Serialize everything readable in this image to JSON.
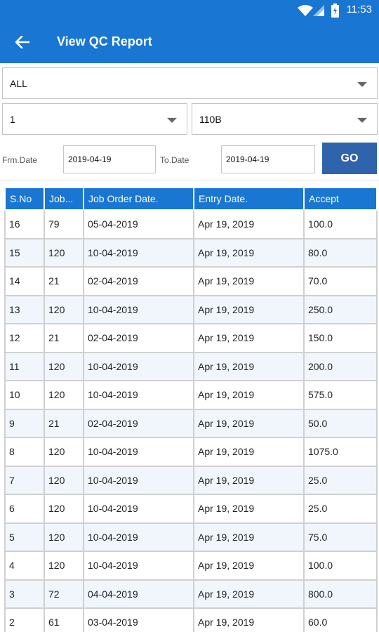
{
  "status_bar": {
    "time": "11:53"
  },
  "header": {
    "title": "View QC Report"
  },
  "filters": {
    "type_select": "ALL",
    "number_select": "1",
    "code_select": "110B",
    "from_label": "Frm.Date",
    "from_value": "2019-04-19",
    "to_label": "To.Date",
    "to_value": "2019-04-19",
    "go_label": "GO"
  },
  "table": {
    "columns": [
      "S.No",
      "Job...",
      "Job Order Date.",
      "Entry Date.",
      "Accept"
    ],
    "rows": [
      [
        "16",
        "79",
        "05-04-2019",
        "Apr 19, 2019",
        "100.0"
      ],
      [
        "15",
        "120",
        "10-04-2019",
        "Apr 19, 2019",
        "80.0"
      ],
      [
        "14",
        "21",
        "02-04-2019",
        "Apr 19, 2019",
        "70.0"
      ],
      [
        "13",
        "120",
        "10-04-2019",
        "Apr 19, 2019",
        "250.0"
      ],
      [
        "12",
        "21",
        "02-04-2019",
        "Apr 19, 2019",
        "150.0"
      ],
      [
        "11",
        "120",
        "10-04-2019",
        "Apr 19, 2019",
        "200.0"
      ],
      [
        "10",
        "120",
        "10-04-2019",
        "Apr 19, 2019",
        "575.0"
      ],
      [
        "9",
        "21",
        "02-04-2019",
        "Apr 19, 2019",
        "50.0"
      ],
      [
        "8",
        "120",
        "10-04-2019",
        "Apr 19, 2019",
        "1075.0"
      ],
      [
        "7",
        "120",
        "10-04-2019",
        "Apr 19, 2019",
        "25.0"
      ],
      [
        "6",
        "120",
        "10-04-2019",
        "Apr 19, 2019",
        "25.0"
      ],
      [
        "5",
        "120",
        "10-04-2019",
        "Apr 19, 2019",
        "75.0"
      ],
      [
        "4",
        "120",
        "10-04-2019",
        "Apr 19, 2019",
        "100.0"
      ],
      [
        "3",
        "72",
        "04-04-2019",
        "Apr 19, 2019",
        "800.0"
      ],
      [
        "2",
        "61",
        "03-04-2019",
        "Apr 19, 2019",
        "60.0"
      ]
    ]
  },
  "colors": {
    "primary": "#1976d2",
    "go_button": "#2f63ab",
    "serial_text": "#e91e63",
    "row_alt": "#f0f6fc"
  },
  "icons": {
    "back": "arrow-left",
    "dropdown": "triangle-down",
    "wifi": "wifi",
    "signal": "cell-signal",
    "battery": "battery"
  }
}
